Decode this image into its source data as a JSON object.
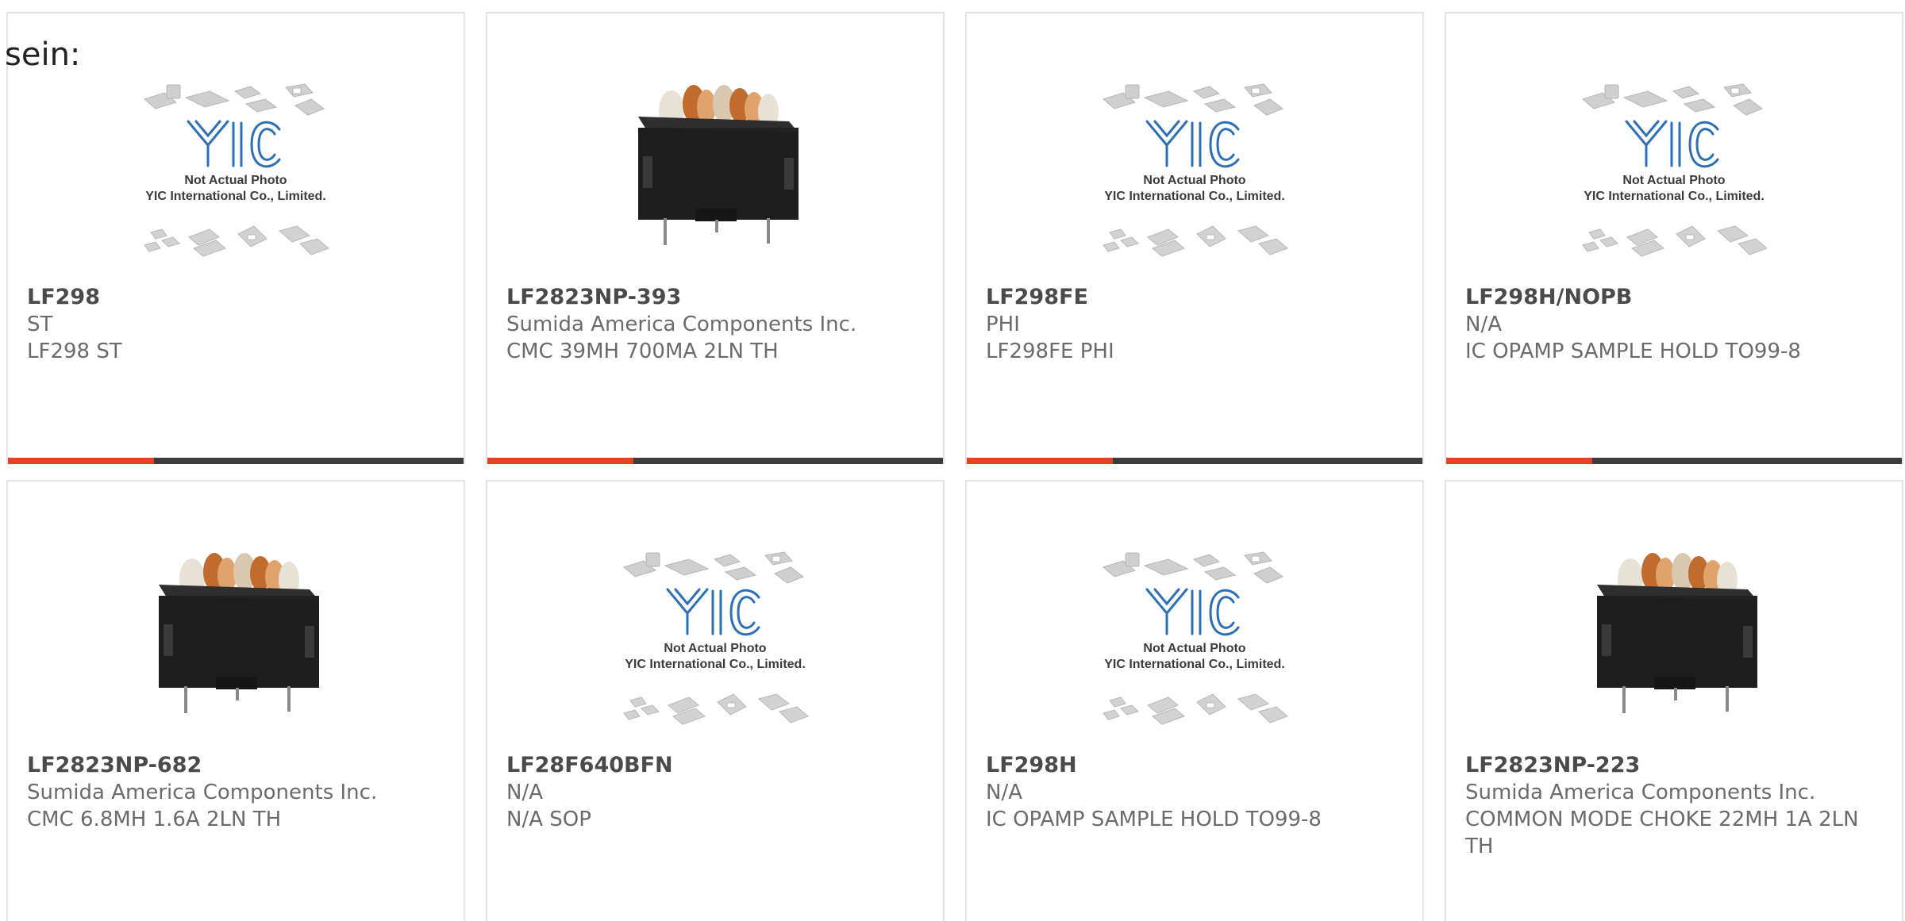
{
  "intro": {
    "text": "sein:"
  },
  "colors": {
    "accent": "#e2441e",
    "track": "#3b3b3b",
    "card_border": "#e3e3e3",
    "title": "#4a4a4a",
    "body": "#6b6b6b"
  },
  "placeholder": {
    "line1": "Not Actual Photo",
    "line2": "YIC International Co., Limited."
  },
  "cards": [
    {
      "part": "LF298",
      "maker": "ST",
      "desc": "LF298 ST",
      "image": "placeholder",
      "progress": 0.32
    },
    {
      "part": "LF2823NP-393",
      "maker": "Sumida America Components Inc.",
      "desc": "CMC 39MH 700MA 2LN TH",
      "image": "inductor",
      "progress": 0.32
    },
    {
      "part": "LF298FE",
      "maker": "PHI",
      "desc": "LF298FE PHI",
      "image": "placeholder",
      "progress": 0.32
    },
    {
      "part": "LF298H/NOPB",
      "maker": "N/A",
      "desc": "IC OPAMP SAMPLE HOLD TO99-8",
      "image": "placeholder",
      "progress": 0.32
    },
    {
      "part": "LF2823NP-682",
      "maker": "Sumida America Components Inc.",
      "desc": "CMC 6.8MH 1.6A 2LN TH",
      "image": "inductor"
    },
    {
      "part": "LF28F640BFN",
      "maker": "N/A",
      "desc": "N/A SOP",
      "image": "placeholder"
    },
    {
      "part": "LF298H",
      "maker": "N/A",
      "desc": "IC OPAMP SAMPLE HOLD TO99-8",
      "image": "placeholder"
    },
    {
      "part": "LF2823NP-223",
      "maker": "Sumida America Components Inc.",
      "desc": "COMMON MODE CHOKE 22MH 1A 2LN TH",
      "image": "inductor"
    }
  ]
}
